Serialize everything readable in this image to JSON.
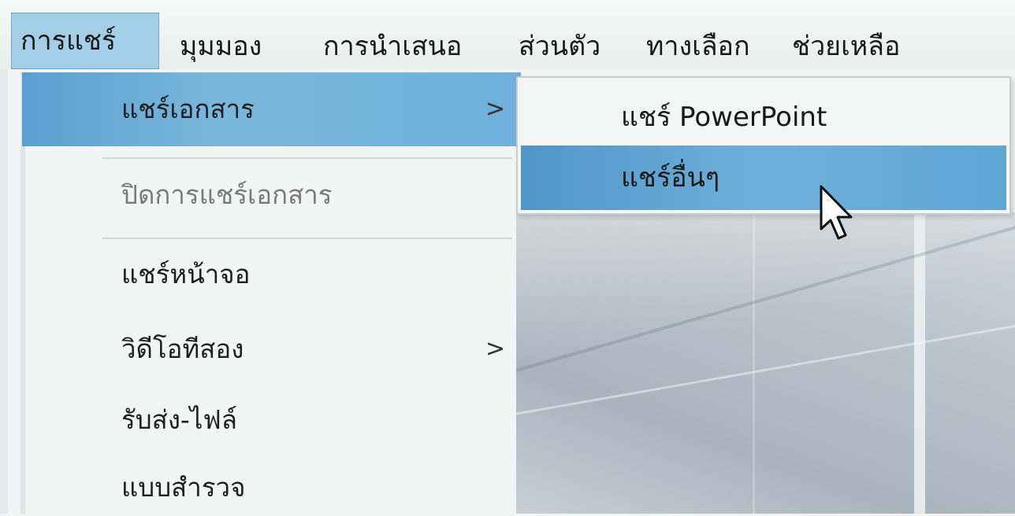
{
  "menubar": {
    "items": [
      {
        "label": "การแชร์",
        "active": true
      },
      {
        "label": "มุมมอง"
      },
      {
        "label": "การนำเสนอ"
      },
      {
        "label": "ส่วนตัว"
      },
      {
        "label": "ทางเลือก"
      },
      {
        "label": "ช่วยเหลือ"
      }
    ]
  },
  "dropdown": {
    "items": [
      {
        "label": "แชร์เอกสาร",
        "highlighted": true,
        "has_submenu": true,
        "chevron": ">"
      },
      {
        "label": "ปิดการแชร์เอกสาร",
        "disabled": true
      },
      {
        "label": "แชร์หน้าจอ"
      },
      {
        "label": "วิดีโอทีสอง",
        "has_submenu": true,
        "chevron": ">"
      },
      {
        "label": "รับส่ง-ไฟล์"
      },
      {
        "label": "แบบสำรวจ"
      }
    ]
  },
  "submenu": {
    "items": [
      {
        "label": "แชร์ PowerPoint"
      },
      {
        "label": "แชร์อื่นๆ",
        "highlighted": true
      }
    ]
  },
  "cursor": {
    "icon": "arrow-cursor-icon"
  },
  "colors": {
    "highlight": "#6fb0da",
    "active_menu": "#a5cfe6",
    "menu_bg": "#f3f4f4",
    "text": "#1a1a1a",
    "disabled_text": "#7a7a7a"
  }
}
